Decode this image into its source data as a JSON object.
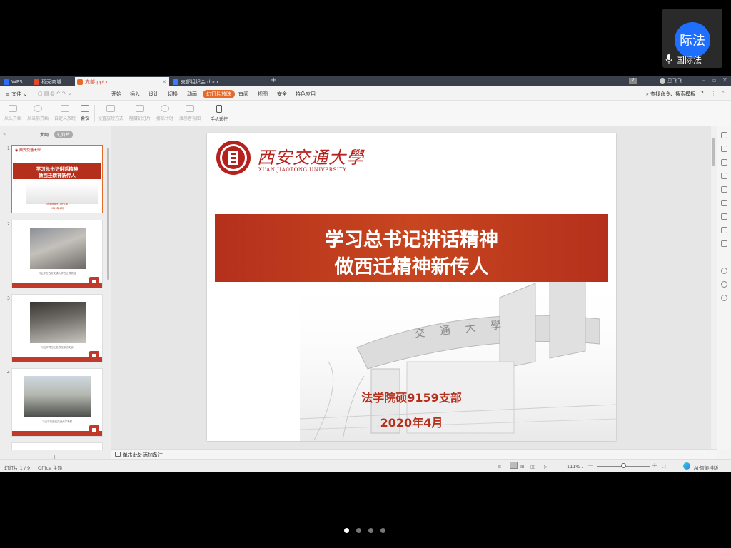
{
  "participant": {
    "avatar_text": "际法",
    "name": "国际法"
  },
  "tabs": [
    {
      "label": "WPS",
      "active": false
    },
    {
      "label": "稻壳商城",
      "active": false
    },
    {
      "label": "支部.pptx",
      "active": true
    },
    {
      "label": "支部组织会.docx",
      "active": false
    }
  ],
  "tabbar": {
    "new_tab": "+",
    "badge": "2",
    "user_name": "马飞飞"
  },
  "menubar": {
    "file": "≡ 文件 ⌄",
    "items": [
      "开始",
      "插入",
      "设计",
      "切换",
      "动画",
      "幻灯片放映",
      "审阅",
      "视图",
      "安全",
      "特色应用"
    ],
    "search": "查找命令、搜索模板",
    "help": "?"
  },
  "ribbon": {
    "buttons": [
      "从头开始",
      "从当前开始",
      "自定义放映",
      "会议",
      "设置放映方式",
      "隐藏幻灯片",
      "排练计时",
      "演示者视图",
      "手机遥控"
    ]
  },
  "panel": {
    "tab_outline": "大纲",
    "tab_slides": "幻灯片",
    "add": "+",
    "thumbnails": [
      {
        "num": "1",
        "title_1": "学习总书记讲话精神",
        "title_2": "做西迁精神新传人",
        "sub_1": "法学院硕9159支部",
        "sub_2": "2020年4月"
      },
      {
        "num": "2",
        "caption": "习近平在西安交通大学西迁博物馆"
      },
      {
        "num": "3",
        "caption": "习近平同西迁老教授亲切交谈"
      },
      {
        "num": "4",
        "caption": "习近平在西安交通大学考察"
      }
    ]
  },
  "slide": {
    "university_cn": "西安交通大學",
    "university_en": "XI'AN JIAOTONG UNIVERSITY",
    "title_line1": "学习总书记讲话精神",
    "title_line2": "做西迁精神新传人",
    "branch": "法学院硕9159支部",
    "date": "2020年4月",
    "gate_text": "交 通 大 學"
  },
  "notes": {
    "placeholder": "单击此处添加备注"
  },
  "status": {
    "slide_counter": "幻灯片 1 / 9",
    "theme": "Office 主题",
    "zoom": "111%",
    "zoom_fraction": 0.5,
    "ai": "AI·智能排版"
  },
  "pager": {
    "count": 4,
    "active": 0
  },
  "colors": {
    "accent": "#e86a2b",
    "brand_red": "#b5301c",
    "avatar_blue": "#1f6fff"
  }
}
